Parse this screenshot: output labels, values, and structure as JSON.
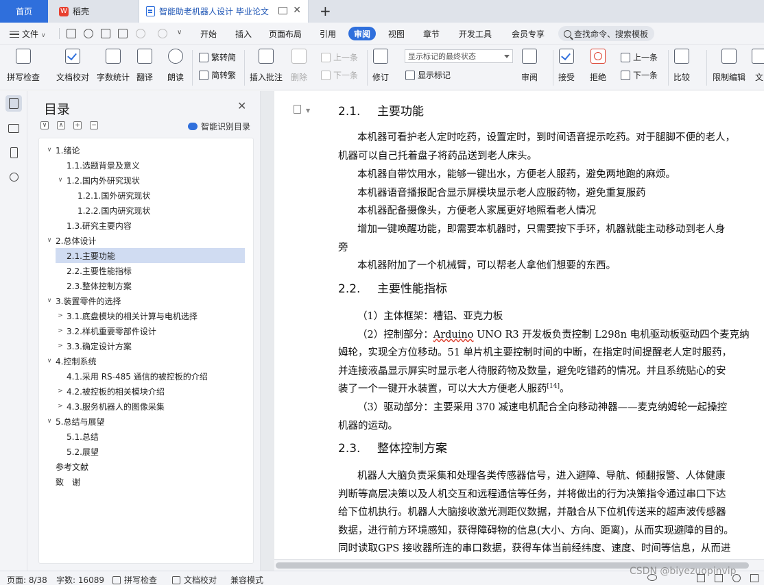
{
  "tabs": {
    "home": "首页",
    "daoke": "稻壳",
    "doc": "智能助老机器人设计 毕业论文"
  },
  "menu": {
    "file": "文件",
    "items": [
      "开始",
      "插入",
      "页面布局",
      "引用",
      "审阅",
      "视图",
      "章节",
      "开发工具",
      "会员专享"
    ],
    "active": "审阅",
    "search": "查找命令、搜索模板"
  },
  "ribbon": {
    "spell": "拼写检查",
    "proof": "文档校对",
    "wordcount": "字数统计",
    "translate": "翻译",
    "read": "朗读",
    "to_trad": "繁转简",
    "to_simp": "简转繁",
    "insert_comment": "插入批注",
    "delete": "删除",
    "prev": "上一条",
    "next": "下一条",
    "revise": "修订",
    "markup_state": "显示标记的最终状态",
    "show_markup": "显示标记",
    "review": "审阅",
    "accept": "接受",
    "reject": "拒绝",
    "prev2": "上一条",
    "next2": "下一条",
    "compare": "比较",
    "restrict": "限制编辑",
    "doc_cut": "文"
  },
  "toc": {
    "title": "目录",
    "smart": "智能识别目录",
    "items": [
      {
        "label": "1.绪论",
        "level": 1,
        "arrow": "v"
      },
      {
        "label": "1.1.选题背景及意义",
        "level": 2,
        "arrow": ""
      },
      {
        "label": "1.2.国内外研究现状",
        "level": 2,
        "arrow": "v"
      },
      {
        "label": "1.2.1.国外研究现状",
        "level": 3,
        "arrow": ""
      },
      {
        "label": "1.2.2.国内研究现状",
        "level": 3,
        "arrow": ""
      },
      {
        "label": "1.3.研究主要内容",
        "level": 2,
        "arrow": ""
      },
      {
        "label": "2.总体设计",
        "level": 1,
        "arrow": "v"
      },
      {
        "label": "2.1.主要功能",
        "level": 2,
        "arrow": ""
      },
      {
        "label": "2.2.主要性能指标",
        "level": 2,
        "arrow": ""
      },
      {
        "label": "2.3.整体控制方案",
        "level": 2,
        "arrow": ""
      },
      {
        "label": "3.装置零件的选择",
        "level": 1,
        "arrow": "v"
      },
      {
        "label": "3.1.底盘模块的相关计算与电机选择",
        "level": 2,
        "arrow": ">"
      },
      {
        "label": "3.2.样机重要零部件设计",
        "level": 2,
        "arrow": ">"
      },
      {
        "label": "3.3.确定设计方案",
        "level": 2,
        "arrow": ">"
      },
      {
        "label": "4.控制系统",
        "level": 1,
        "arrow": "v"
      },
      {
        "label": "4.1.采用 RS-485 通信的被控板的介绍",
        "level": 2,
        "arrow": ""
      },
      {
        "label": "4.2.被控板的相关模块介绍",
        "level": 2,
        "arrow": ">"
      },
      {
        "label": "4.3.服务机器人的图像采集",
        "level": 2,
        "arrow": ">"
      },
      {
        "label": "5.总结与展望",
        "level": 1,
        "arrow": "v"
      },
      {
        "label": "5.1.总结",
        "level": 2,
        "arrow": ""
      },
      {
        "label": "5.2.展望",
        "level": 2,
        "arrow": ""
      },
      {
        "label": "参考文献",
        "level": 1,
        "arrow": ""
      },
      {
        "label": "致　谢",
        "level": 1,
        "arrow": ""
      }
    ],
    "selected": "2.1.主要功能"
  },
  "doc": {
    "h21_num": "2.1.",
    "h21_title": "主要功能",
    "p1a": "本机器可看护老人定时吃药，设置定时，到时间语音提示吃药。对于腿脚不便的老人，",
    "p1b": "机器可以自己托着盘子将药品送到老人床头。",
    "p2": "本机器自带饮用水，能够一键出水，方便老人服药，避免两地跑的麻烦。",
    "p3": "本机器语音播报配合显示屏模块显示老人应服药物，避免重复服药",
    "p4": "本机器配备摄像头，方便老人家属更好地照看老人情况",
    "p5a": "增加一键唤醒功能，即需要本机器时，只需要按下手环，机器就能主动移动到老人身",
    "p5b": "旁",
    "p6": "本机器附加了一个机械臂，可以帮老人拿他们想要的东西。",
    "h22_num": "2.2.",
    "h22_title": "主要性能指标",
    "q1": "（1）主体框架：槽铝、亚克力板",
    "q2a_pre": "（2）控制部分：",
    "q2a_ul": "Arduino",
    "q2a_post": " UNO R3 开发板负责控制 L298n  电机驱动板驱动四个麦克纳",
    "q2b": "姆轮，实现全方位移动。51 单片机主要控制时间的中断，在指定时间提醒老人定时服药，",
    "q2c": "并连接液晶显示屏实时显示老人待服药物及数量，避免吃错药的情况。并且系统贴心的安",
    "q2d": "装了一个一键开水装置，可以大大方便老人服药",
    "q2d_ref": "[14]",
    "q2d_end": "。",
    "q3a": "（3）驱动部分：主要采用 370 减速电机配合全向移动神器——麦克纳姆轮一起操控",
    "q3b": "机器的运动。",
    "h23_num": "2.3.",
    "h23_title": "整体控制方案",
    "r1": "机器人大脑负责采集和处理各类传感器信号，进入避障、导航、倾翻报警、人体健康",
    "r2": "判断等高层决策以及人机交互和远程通信等任务，并将做出的行为决策指令通过串口下达",
    "r3": "给下位机执行。机器人大脑接收激光测距仪数据，并融合从下位机传送来的超声波传感器",
    "r4": "数据，进行前方环境感知，获得障碍物的信息(大小、方向、距离)，从而实现避障的目的。",
    "r5": "同时读取GPS  接收器所连的串口数据，获得车体当前经纬度、速度、时间等信息，从而进"
  },
  "status": {
    "page": "页面: 8/38",
    "words": "字数: 16089",
    "spell": "拼写检查",
    "proof": "文档校对",
    "compat": "兼容模式"
  },
  "watermark": "CSDN @biyezuopinvip"
}
